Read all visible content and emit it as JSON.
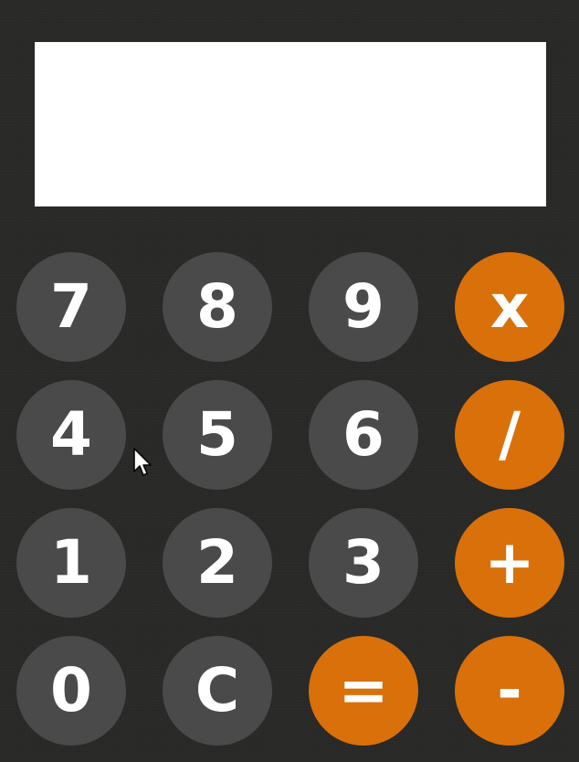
{
  "display": {
    "value": ""
  },
  "keys": {
    "seven": "7",
    "eight": "8",
    "nine": "9",
    "multiply": "x",
    "four": "4",
    "five": "5",
    "six": "6",
    "divide": "/",
    "one": "1",
    "two": "2",
    "three": "3",
    "add": "+",
    "zero": "0",
    "clear": "C",
    "equals": "=",
    "subtract": "-"
  },
  "colors": {
    "background": "#282826",
    "digit_key": "#4a4a4a",
    "operator_key": "#d9700a",
    "display": "#ffffff",
    "key_text": "#ffffff"
  },
  "icons": {
    "pointer": "mouse-pointer-icon"
  }
}
